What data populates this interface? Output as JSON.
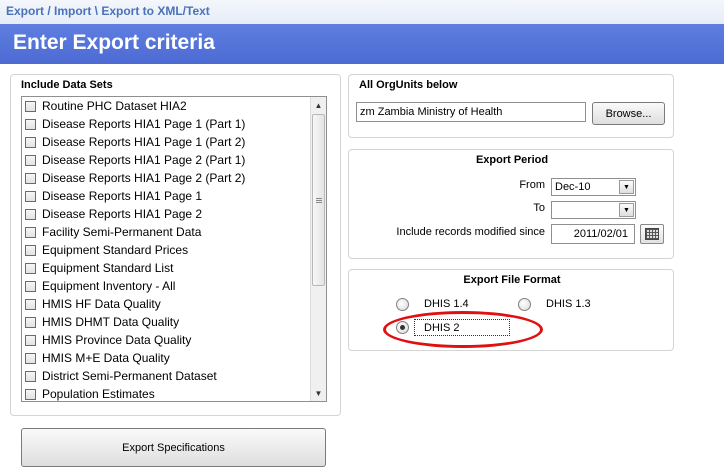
{
  "breadcrumb": "Export / Import \\ Export to XML/Text",
  "page_title": "Enter Export criteria",
  "datasets": {
    "title": "Include Data Sets",
    "items": [
      {
        "label": "Routine PHC Dataset HIA2",
        "checked": false
      },
      {
        "label": "Disease Reports HIA1 Page 1 (Part 1)",
        "checked": false
      },
      {
        "label": "Disease Reports HIA1 Page 1 (Part 2)",
        "checked": false
      },
      {
        "label": "Disease Reports HIA1 Page 2 (Part 1)",
        "checked": false
      },
      {
        "label": "Disease Reports HIA1 Page 2 (Part 2)",
        "checked": false
      },
      {
        "label": "Disease Reports HIA1 Page 1",
        "checked": false
      },
      {
        "label": "Disease Reports HIA1 Page 2",
        "checked": false
      },
      {
        "label": "Facility Semi-Permanent Data",
        "checked": false
      },
      {
        "label": "Equipment Standard Prices",
        "checked": false
      },
      {
        "label": "Equipment Standard List",
        "checked": false
      },
      {
        "label": "Equipment Inventory - All",
        "checked": false
      },
      {
        "label": "HMIS HF Data Quality",
        "checked": false
      },
      {
        "label": "HMIS DHMT Data Quality",
        "checked": false
      },
      {
        "label": "HMIS Province Data Quality",
        "checked": false
      },
      {
        "label": "HMIS M+E Data Quality",
        "checked": false
      },
      {
        "label": "District Semi-Permanent Dataset",
        "checked": false
      },
      {
        "label": "Population Estimates",
        "checked": false
      }
    ]
  },
  "orgunits": {
    "title": "All OrgUnits below",
    "value": "zm Zambia Ministry of Health",
    "browse_label": "Browse..."
  },
  "period": {
    "title": "Export Period",
    "from_label": "From",
    "from_value": "Dec-10",
    "to_label": "To",
    "to_value": "",
    "modified_label": "Include records modified since",
    "modified_value": "2011/02/01"
  },
  "format": {
    "title": "Export File Format",
    "options": [
      {
        "label": "DHIS 1.4",
        "selected": false
      },
      {
        "label": "DHIS 1.3",
        "selected": false
      },
      {
        "label": "DHIS 2",
        "selected": true
      }
    ],
    "highlight_color": "#e01010"
  },
  "export_button": "Export Specifications",
  "colors": {
    "header": "#5676db",
    "breadcrumb": "#4a72b8"
  }
}
